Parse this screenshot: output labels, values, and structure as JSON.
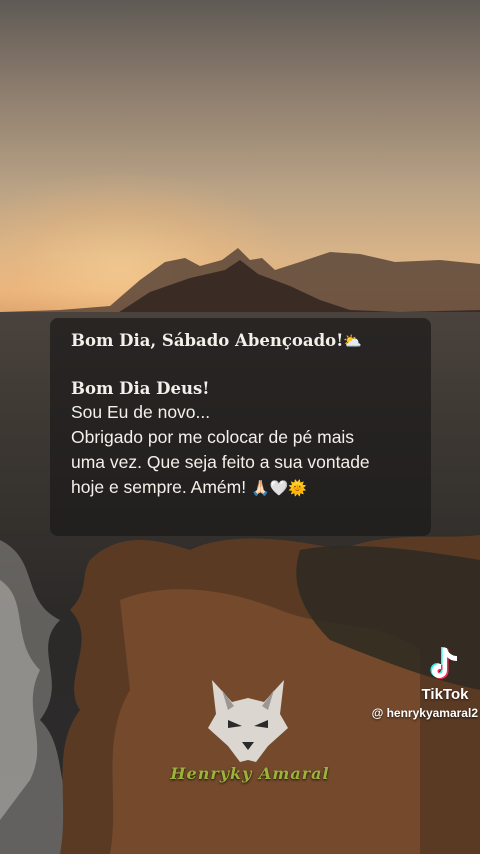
{
  "caption": {
    "title": "Bom Dia, Sábado Abençoado!",
    "title_emoji": "⛅",
    "greeting": "Bom Dia Deus!",
    "lines": [
      "Sou Eu de novo...",
      "Obrigado por me colocar de pé mais",
      "uma vez. Que seja feito a sua vontade",
      "hoje e sempre. Amém!"
    ],
    "closing_emojis": "🙏🏻🤍🌞"
  },
  "watermark": {
    "app_name": "TikTok",
    "username": "@ henrykyamaral2",
    "icon": "tiktok-note-icon"
  },
  "brand": {
    "name": "Henryky Amaral",
    "logo_icon": "wolf-head-icon",
    "color": "#9cb23a"
  },
  "colors": {
    "caption_bg": "#1c1a1a",
    "caption_text": "#f3efe9",
    "sky_top": "#5f5a55",
    "horizon": "#e6b47f"
  }
}
